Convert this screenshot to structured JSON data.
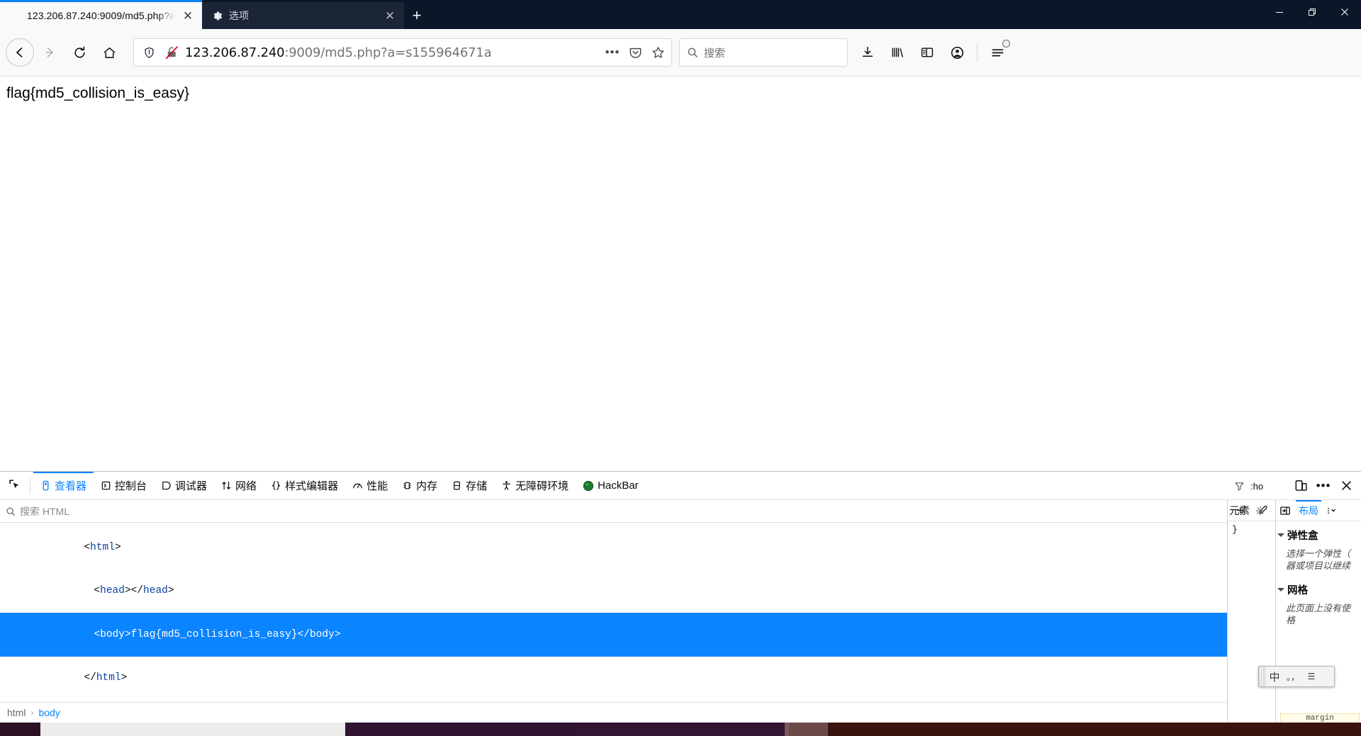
{
  "window": {
    "minimize_label": "–",
    "restore_label": "❐",
    "close_label": "✕"
  },
  "tabs": {
    "items": [
      {
        "title": "123.206.87.240:9009/md5.php?a",
        "favicon": "none-icon",
        "active": true,
        "close_label": "✕"
      },
      {
        "title": "选项",
        "favicon": "gear-icon",
        "active": false,
        "close_label": "✕"
      }
    ],
    "new_tab_label": "+"
  },
  "navbar": {
    "back_label": "←",
    "forward_label": "→",
    "reload_label": "↻",
    "home_label": "⌂",
    "url": {
      "host": "123.206.87.240",
      "rest": ":9009/md5.php?a=s155964671a",
      "full": "123.206.87.240:9009/md5.php?a=s155964671a",
      "shield_icon": "shield-icon",
      "insecure_icon": "broken-lock-icon",
      "page_actions_label": "•••",
      "pocket_icon": "pocket-icon",
      "bookmark_icon": "star-icon"
    },
    "search": {
      "placeholder": "搜索",
      "icon": "search-icon"
    },
    "right_icons": [
      {
        "name": "downloads-icon"
      },
      {
        "name": "library-icon"
      },
      {
        "name": "sidebar-icon"
      },
      {
        "name": "account-icon"
      },
      {
        "name": "app-menu-icon",
        "badge": true
      }
    ]
  },
  "page": {
    "body_text": "flag{md5_collision_is_easy}"
  },
  "devtools": {
    "picker_icon": "element-picker-icon",
    "tabs": [
      {
        "label": "查看器",
        "icon": "inspector-icon",
        "active": true
      },
      {
        "label": "控制台",
        "icon": "console-icon",
        "active": false
      },
      {
        "label": "调试器",
        "icon": "debugger-icon",
        "active": false
      },
      {
        "label": "网络",
        "icon": "network-icon",
        "active": false
      },
      {
        "label": "样式编辑器",
        "icon": "style-editor-icon",
        "active": false
      },
      {
        "label": "性能",
        "icon": "performance-icon",
        "active": false
      },
      {
        "label": "内存",
        "icon": "memory-icon",
        "active": false
      },
      {
        "label": "存储",
        "icon": "storage-icon",
        "active": false
      },
      {
        "label": "无障碍环境",
        "icon": "accessibility-icon",
        "active": false
      },
      {
        "label": "HackBar",
        "icon": "hackbar-icon",
        "active": false
      }
    ],
    "right_icons": [
      {
        "name": "responsive-design-mode-icon"
      },
      {
        "name": "devtools-menu-icon",
        "label": "•••"
      },
      {
        "name": "close-devtools-icon",
        "label": "✕"
      }
    ],
    "search": {
      "placeholder": "搜索 HTML",
      "icon": "search-icon"
    },
    "markup": {
      "lines": [
        {
          "indent": 0,
          "text": "<html>",
          "selected": false
        },
        {
          "indent": 1,
          "text": "<head></head>",
          "selected": false
        },
        {
          "indent": 1,
          "text": "<body>flag{md5_collision_is_easy}</body>",
          "selected": true
        },
        {
          "indent": 0,
          "text": "</html>",
          "selected": false
        }
      ]
    },
    "breadcrumb": {
      "items": [
        "html",
        "body"
      ],
      "separator": "›"
    },
    "rules_pane": {
      "add_rule_label": "+",
      "eyedropper_icon": "eyedropper-icon",
      "filter_icon": "filter-icon",
      "pseudo_label": ":ho",
      "tab_label": "元素",
      "settings_icon": "gear-icon",
      "closing_brace": "}"
    },
    "layout_pane": {
      "toggle_icon": "panel-toggle-icon",
      "tab_label": "布局",
      "menu_label": "⋮",
      "sections": [
        {
          "title": "弹性盒",
          "note": "选择一个弹性（\n器或项目以继续"
        },
        {
          "title": "网格",
          "note": "此页面上没有使\n格"
        }
      ],
      "box_model_label": "margin"
    }
  },
  "ime": {
    "buttons": [
      {
        "label": "中",
        "name": "ime-mode-chinese"
      },
      {
        "label": "。，",
        "name": "ime-punctuation"
      },
      {
        "label": "☰",
        "name": "ime-toolbox"
      }
    ]
  },
  "colors": {
    "accent": "#0a84ff",
    "chrome_dark": "#0b1728",
    "tab_inactive": "#1c2536",
    "toolbar_bg": "#f9f9fa",
    "taskbar": "#2a1224"
  }
}
